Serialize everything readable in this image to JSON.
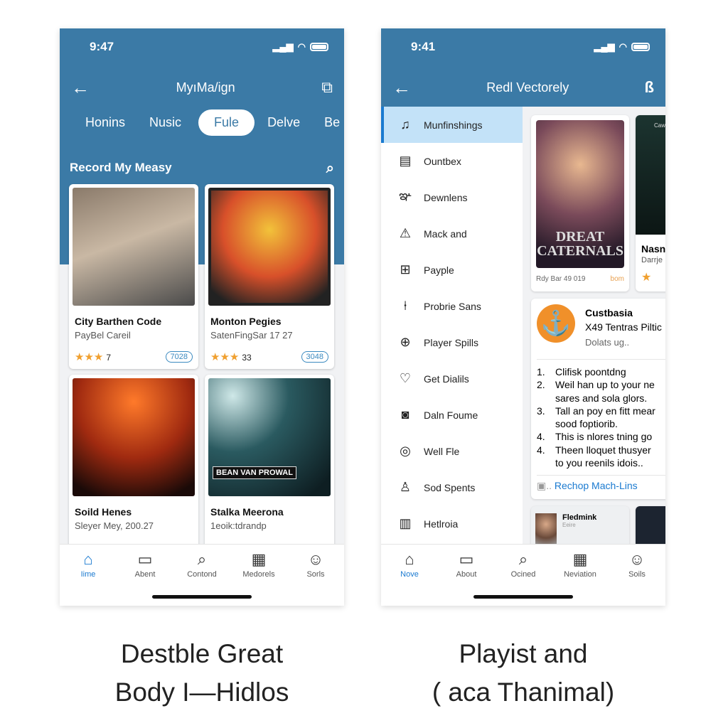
{
  "left": {
    "status": {
      "time": "9:47"
    },
    "title": "MyıMa/ign",
    "tabs": [
      "Honins",
      "Nusic",
      "Fule",
      "Delve",
      "Be"
    ],
    "active_tab": "Fule",
    "section_title": "Record My Measy",
    "cards": [
      {
        "title": "City Barthen Code",
        "subtitle": "PayBel Careil",
        "rating": "7",
        "badge": "7028"
      },
      {
        "title": "Monton Pegies",
        "subtitle": "SatenFingSar 17 27",
        "rating": "33",
        "badge": "3048"
      },
      {
        "title": "Soild Henes",
        "subtitle": "Sleyer Mey, 200.27",
        "rating": "",
        "badge": ""
      },
      {
        "title": "Stalka Meerona",
        "subtitle": "1eoik:tdrandp",
        "rating": "",
        "badge": "",
        "poster_text": "BEAN VAN PROWAL"
      }
    ],
    "bottom_nav": [
      {
        "label": "Iime",
        "icon": "home-icon"
      },
      {
        "label": "Abent",
        "icon": "folder-icon"
      },
      {
        "label": "Contond",
        "icon": "search-icon"
      },
      {
        "label": "Medorels",
        "icon": "calendar-icon"
      },
      {
        "label": "Sorls",
        "icon": "user-icon"
      }
    ]
  },
  "right": {
    "status": {
      "time": "9:41"
    },
    "title": "Redl Vectorely",
    "sidebar": [
      {
        "label": "Munfinshings",
        "icon": "music-note-icon"
      },
      {
        "label": "Ountbex",
        "icon": "book-icon"
      },
      {
        "label": "Dewnlens",
        "icon": "mask-icon"
      },
      {
        "label": "Mack and",
        "icon": "alert-icon"
      },
      {
        "label": "Payple",
        "icon": "badge-icon"
      },
      {
        "label": "Probrie Sans",
        "icon": "pin-icon"
      },
      {
        "label": "Player Spills",
        "icon": "plus-circle-icon"
      },
      {
        "label": "Get Dialils",
        "icon": "heart-icon"
      },
      {
        "label": "Daln Foume",
        "icon": "camera-icon"
      },
      {
        "label": "Well Fle",
        "icon": "compass-icon"
      },
      {
        "label": "Sod Spents",
        "icon": "user-icon"
      },
      {
        "label": "Hetlroia",
        "icon": "document-icon"
      }
    ],
    "feature_card": {
      "poster_text": "DREAT CATERNALS",
      "meta": "Rdy Bar 49 019",
      "tag": "bom"
    },
    "side_card": {
      "top_text": "Caw",
      "title": "Nasn",
      "subtitle": "Darrje"
    },
    "info_card": {
      "title": "Custbasia",
      "subtitle": "X49 Tentras Piltic",
      "desc": "Dolats ug..",
      "list": [
        {
          "n": "1.",
          "t": "Clifisk poontdng"
        },
        {
          "n": "2.",
          "t": "Weil han up to your ne"
        },
        {
          "n": "",
          "t": "sares and sola glors."
        },
        {
          "n": "3.",
          "t": "Tall an poy en fitt mear"
        },
        {
          "n": "",
          "t": "sood foptiorib."
        },
        {
          "n": "4.",
          "t": "This is nlores tning go"
        },
        {
          "n": "4.",
          "t": "Theen lloquet thusyer"
        },
        {
          "n": "",
          "t": "to you reenils idois.."
        }
      ],
      "link": "Rechop Mach-Lins"
    },
    "mini_card": {
      "title": "Fledmink",
      "sub": "Eeire"
    },
    "bottom_nav": [
      {
        "label": "Nove",
        "icon": "home-icon"
      },
      {
        "label": "About",
        "icon": "folder-icon"
      },
      {
        "label": "Ocined",
        "icon": "search-icon"
      },
      {
        "label": "Neviation",
        "icon": "calendar-icon"
      },
      {
        "label": "Soils",
        "icon": "user-icon"
      }
    ]
  },
  "captions": {
    "left": [
      "Destble Great",
      "Body I—Hidlos"
    ],
    "right": [
      "Playist and",
      "( aca Thanimal)"
    ]
  },
  "colors": {
    "header": "#3b7aa6",
    "accent": "#1a7ad0",
    "sidebar_active": "#c3e2f8",
    "anchor": "#f0902a"
  }
}
